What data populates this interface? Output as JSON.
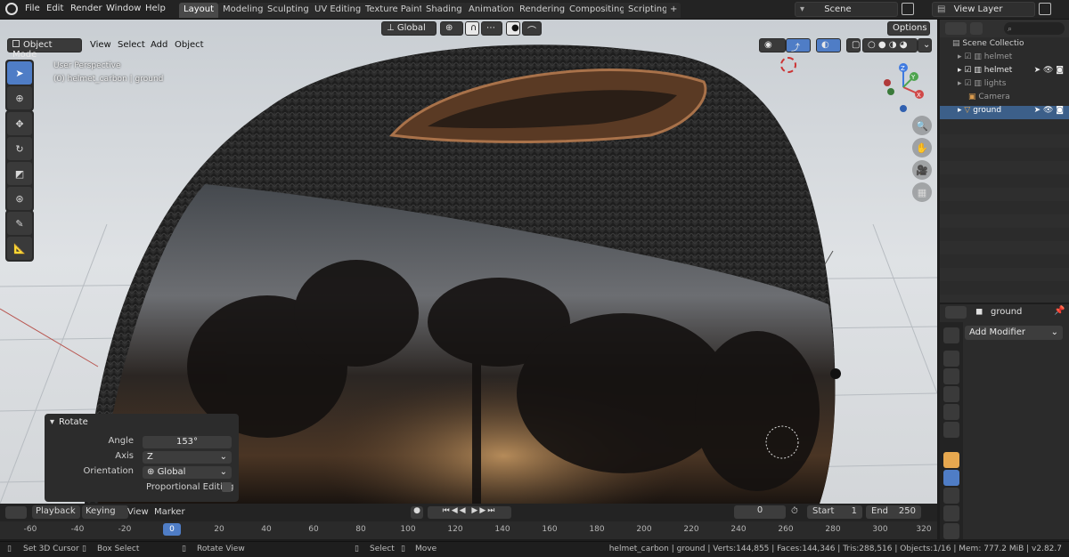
{
  "top_menu": {
    "items": [
      "File",
      "Edit",
      "Render",
      "Window",
      "Help"
    ],
    "workspace_tabs": [
      "Layout",
      "Modeling",
      "Sculpting",
      "UV Editing",
      "Texture Paint",
      "Shading",
      "Animation",
      "Rendering",
      "Compositing",
      "Scripting"
    ],
    "active_tab": "Layout",
    "add_tab": "+",
    "scene": "Scene",
    "view_layer": "View Layer"
  },
  "viewport": {
    "mode": "Object Mode",
    "menus": [
      "View",
      "Select",
      "Add",
      "Object"
    ],
    "orientation": "Global",
    "options_label": "Options",
    "perspective_label": "User Perspective",
    "object_info": "(0) helmet_carbon | ground",
    "gizmo_axes": [
      "X",
      "Y",
      "Z"
    ]
  },
  "rotate_panel": {
    "title": "Rotate",
    "angle_label": "Angle",
    "angle_value": "153°",
    "axis_label": "Axis",
    "axis_value": "Z",
    "orientation_label": "Orientation",
    "orientation_value": "Global",
    "proportional_label": "Proportional Editing"
  },
  "outliner": {
    "root": "Scene Collectio",
    "items": [
      {
        "label": "helmet"
      },
      {
        "label": "helmet"
      },
      {
        "label": "lights"
      },
      {
        "label": "Camera"
      },
      {
        "label": "ground"
      }
    ]
  },
  "properties": {
    "object_name": "ground",
    "add_modifier": "Add Modifier"
  },
  "timeline": {
    "playback": "Playback",
    "keying": "Keying",
    "view": "View",
    "marker": "Marker",
    "current_frame": "0",
    "start_label": "Start",
    "start_value": "1",
    "end_label": "End",
    "end_value": "250",
    "ticks": [
      "-60",
      "-40",
      "-20",
      "0",
      "20",
      "40",
      "60",
      "80",
      "100",
      "120",
      "140",
      "160",
      "180",
      "200",
      "220",
      "240",
      "260",
      "280",
      "300",
      "320"
    ],
    "playhead_value": "0"
  },
  "status_bar": {
    "set_cursor": "Set 3D Cursor",
    "box_select": "Box Select",
    "rotate_view": "Rotate View",
    "select": "Select",
    "move": "Move",
    "stats": "helmet_carbon | ground | Verts:144,855 | Faces:144,346 | Tris:288,516 | Objects:1/16 | Mem: 777.2 MiB | v2.82.7"
  }
}
